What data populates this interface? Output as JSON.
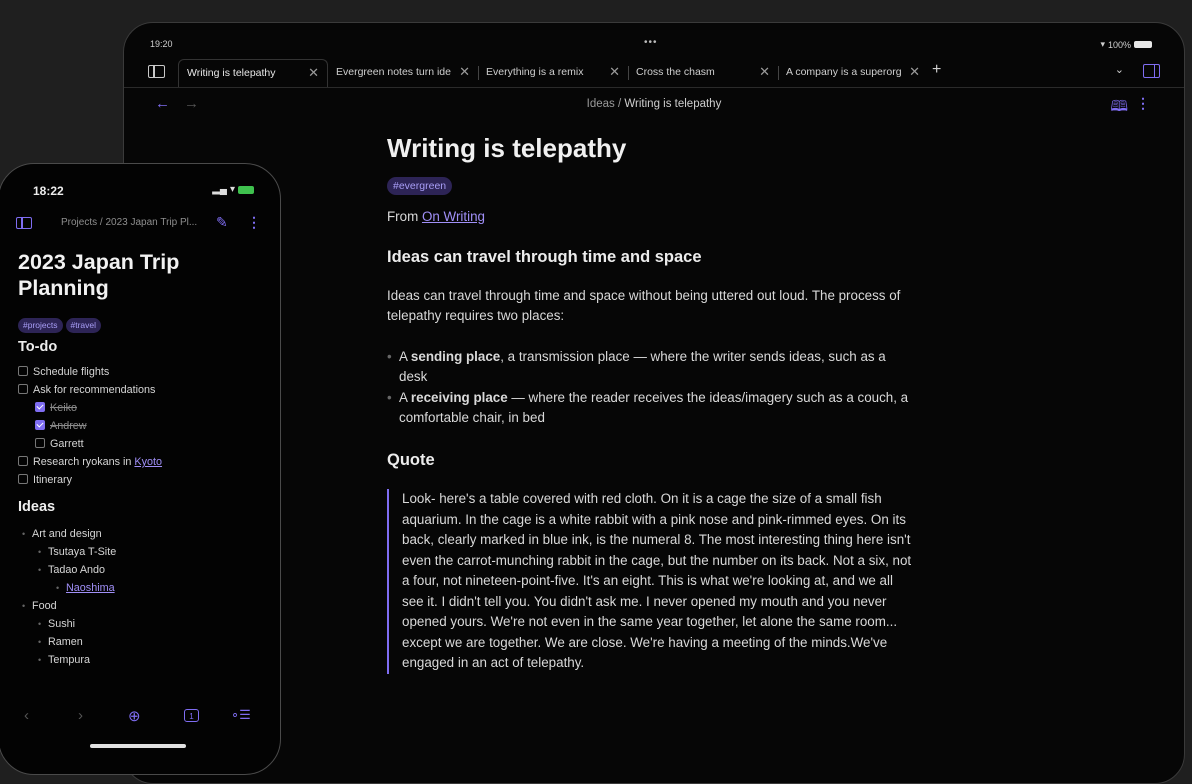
{
  "colors": {
    "accent": "#7f6df2",
    "tag_bg": "#2d2456",
    "background": "#060606"
  },
  "tablet": {
    "status": {
      "time": "19:20",
      "dots": "•••",
      "battery": "100%"
    },
    "tabs": [
      {
        "label": "Writing is telepathy",
        "active": true
      },
      {
        "label": "Evergreen notes turn ide"
      },
      {
        "label": "Everything is a remix"
      },
      {
        "label": "Cross the chasm"
      },
      {
        "label": "A company is a superorg"
      }
    ],
    "tab_close": "✕",
    "tab_add": "+",
    "tab_list": "⌄",
    "nav": {
      "back": "←",
      "forward": "→",
      "read_icon": "reading-mode-icon"
    },
    "breadcrumb": {
      "folder": "Ideas",
      "sep": " / ",
      "note": "Writing is telepathy"
    },
    "note": {
      "title": "Writing is telepathy",
      "tag": "#evergreen",
      "from_prefix": "From ",
      "from_link": "On Writing",
      "heading1": "Ideas can travel through time and space",
      "para1": "Ideas can travel through time and space without being uttered out loud. The process of telepathy requires two places:",
      "bullets": [
        {
          "prefix": "A ",
          "bold": "sending place",
          "rest": ", a transmission place — where the writer sends ideas, such as a desk"
        },
        {
          "prefix": "A ",
          "bold": "receiving place",
          "rest": " — where the reader receives the ideas/imagery such as a couch, a comfortable chair, in bed"
        }
      ],
      "heading2": "Quote",
      "quote": "Look- here's a table covered with red cloth. On it is a cage the size of a small fish aquarium. In the cage is a white rabbit with a pink nose and pink-rimmed eyes. On its back, clearly marked in blue ink, is the numeral 8. The most interesting thing here isn't even the carrot-munching rabbit in the cage, but the number on its back. Not a six, not a four, not nineteen-point-five. It's an eight. This is what we're looking at, and we all see it. I didn't tell you. You didn't ask me. I never opened my mouth and you never opened yours. We're not even in the same year together, let alone the same room... except we are together. We are close. We're having a meeting of the minds.We've engaged in an act of telepathy."
    }
  },
  "phone": {
    "status": {
      "time": "18:22"
    },
    "breadcrumb": "Projects / 2023 Japan Trip Pl...",
    "title": "2023 Japan Trip Planning",
    "tags": [
      "#projects",
      "#travel"
    ],
    "todo_heading": "To-do",
    "todos": [
      {
        "label": "Schedule flights",
        "checked": false
      },
      {
        "label": "Ask for recommendations",
        "checked": false
      },
      {
        "label": "Keiko",
        "checked": true
      },
      {
        "label": "Andrew",
        "checked": true
      },
      {
        "label": "Garrett",
        "checked": false
      },
      {
        "label_prefix": "Research ryokans in ",
        "link": "Kyoto",
        "checked": false
      },
      {
        "label": "Itinerary",
        "checked": false
      }
    ],
    "ideas_heading": "Ideas",
    "ideas": [
      {
        "label": "Art and design"
      },
      {
        "label": "Tsutaya T-Site"
      },
      {
        "label": "Tadao Ando"
      },
      {
        "label": "Naoshima"
      },
      {
        "label": "Food"
      },
      {
        "label": "Sushi"
      },
      {
        "label": "Ramen"
      },
      {
        "label": "Tempura"
      }
    ],
    "bottom_bar": {
      "back": "‹",
      "forward": "›",
      "new": "⊕",
      "tab_count": "1",
      "menu": "∘☰"
    }
  }
}
